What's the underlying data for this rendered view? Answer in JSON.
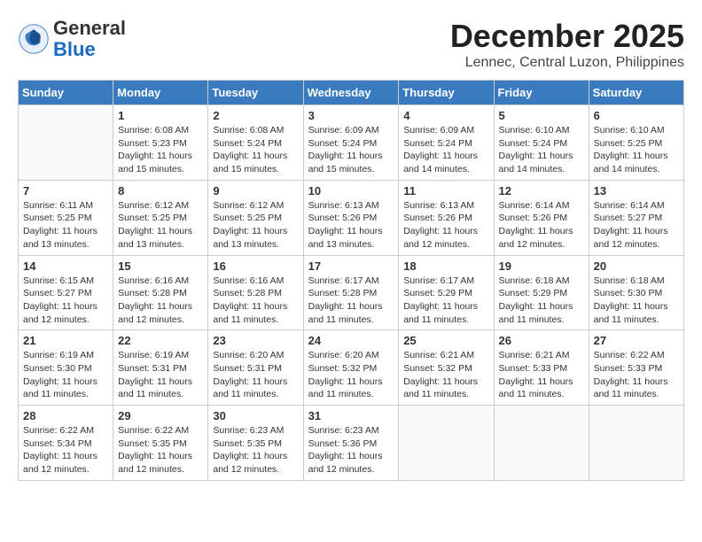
{
  "logo": {
    "general": "General",
    "blue": "Blue"
  },
  "title": "December 2025",
  "location": "Lennec, Central Luzon, Philippines",
  "days_of_week": [
    "Sunday",
    "Monday",
    "Tuesday",
    "Wednesday",
    "Thursday",
    "Friday",
    "Saturday"
  ],
  "weeks": [
    [
      {
        "day": "",
        "info": ""
      },
      {
        "day": "1",
        "info": "Sunrise: 6:08 AM\nSunset: 5:23 PM\nDaylight: 11 hours\nand 15 minutes."
      },
      {
        "day": "2",
        "info": "Sunrise: 6:08 AM\nSunset: 5:24 PM\nDaylight: 11 hours\nand 15 minutes."
      },
      {
        "day": "3",
        "info": "Sunrise: 6:09 AM\nSunset: 5:24 PM\nDaylight: 11 hours\nand 15 minutes."
      },
      {
        "day": "4",
        "info": "Sunrise: 6:09 AM\nSunset: 5:24 PM\nDaylight: 11 hours\nand 14 minutes."
      },
      {
        "day": "5",
        "info": "Sunrise: 6:10 AM\nSunset: 5:24 PM\nDaylight: 11 hours\nand 14 minutes."
      },
      {
        "day": "6",
        "info": "Sunrise: 6:10 AM\nSunset: 5:25 PM\nDaylight: 11 hours\nand 14 minutes."
      }
    ],
    [
      {
        "day": "7",
        "info": "Sunrise: 6:11 AM\nSunset: 5:25 PM\nDaylight: 11 hours\nand 13 minutes."
      },
      {
        "day": "8",
        "info": "Sunrise: 6:12 AM\nSunset: 5:25 PM\nDaylight: 11 hours\nand 13 minutes."
      },
      {
        "day": "9",
        "info": "Sunrise: 6:12 AM\nSunset: 5:25 PM\nDaylight: 11 hours\nand 13 minutes."
      },
      {
        "day": "10",
        "info": "Sunrise: 6:13 AM\nSunset: 5:26 PM\nDaylight: 11 hours\nand 13 minutes."
      },
      {
        "day": "11",
        "info": "Sunrise: 6:13 AM\nSunset: 5:26 PM\nDaylight: 11 hours\nand 12 minutes."
      },
      {
        "day": "12",
        "info": "Sunrise: 6:14 AM\nSunset: 5:26 PM\nDaylight: 11 hours\nand 12 minutes."
      },
      {
        "day": "13",
        "info": "Sunrise: 6:14 AM\nSunset: 5:27 PM\nDaylight: 11 hours\nand 12 minutes."
      }
    ],
    [
      {
        "day": "14",
        "info": "Sunrise: 6:15 AM\nSunset: 5:27 PM\nDaylight: 11 hours\nand 12 minutes."
      },
      {
        "day": "15",
        "info": "Sunrise: 6:16 AM\nSunset: 5:28 PM\nDaylight: 11 hours\nand 12 minutes."
      },
      {
        "day": "16",
        "info": "Sunrise: 6:16 AM\nSunset: 5:28 PM\nDaylight: 11 hours\nand 11 minutes."
      },
      {
        "day": "17",
        "info": "Sunrise: 6:17 AM\nSunset: 5:28 PM\nDaylight: 11 hours\nand 11 minutes."
      },
      {
        "day": "18",
        "info": "Sunrise: 6:17 AM\nSunset: 5:29 PM\nDaylight: 11 hours\nand 11 minutes."
      },
      {
        "day": "19",
        "info": "Sunrise: 6:18 AM\nSunset: 5:29 PM\nDaylight: 11 hours\nand 11 minutes."
      },
      {
        "day": "20",
        "info": "Sunrise: 6:18 AM\nSunset: 5:30 PM\nDaylight: 11 hours\nand 11 minutes."
      }
    ],
    [
      {
        "day": "21",
        "info": "Sunrise: 6:19 AM\nSunset: 5:30 PM\nDaylight: 11 hours\nand 11 minutes."
      },
      {
        "day": "22",
        "info": "Sunrise: 6:19 AM\nSunset: 5:31 PM\nDaylight: 11 hours\nand 11 minutes."
      },
      {
        "day": "23",
        "info": "Sunrise: 6:20 AM\nSunset: 5:31 PM\nDaylight: 11 hours\nand 11 minutes."
      },
      {
        "day": "24",
        "info": "Sunrise: 6:20 AM\nSunset: 5:32 PM\nDaylight: 11 hours\nand 11 minutes."
      },
      {
        "day": "25",
        "info": "Sunrise: 6:21 AM\nSunset: 5:32 PM\nDaylight: 11 hours\nand 11 minutes."
      },
      {
        "day": "26",
        "info": "Sunrise: 6:21 AM\nSunset: 5:33 PM\nDaylight: 11 hours\nand 11 minutes."
      },
      {
        "day": "27",
        "info": "Sunrise: 6:22 AM\nSunset: 5:33 PM\nDaylight: 11 hours\nand 11 minutes."
      }
    ],
    [
      {
        "day": "28",
        "info": "Sunrise: 6:22 AM\nSunset: 5:34 PM\nDaylight: 11 hours\nand 12 minutes."
      },
      {
        "day": "29",
        "info": "Sunrise: 6:22 AM\nSunset: 5:35 PM\nDaylight: 11 hours\nand 12 minutes."
      },
      {
        "day": "30",
        "info": "Sunrise: 6:23 AM\nSunset: 5:35 PM\nDaylight: 11 hours\nand 12 minutes."
      },
      {
        "day": "31",
        "info": "Sunrise: 6:23 AM\nSunset: 5:36 PM\nDaylight: 11 hours\nand 12 minutes."
      },
      {
        "day": "",
        "info": ""
      },
      {
        "day": "",
        "info": ""
      },
      {
        "day": "",
        "info": ""
      }
    ]
  ]
}
